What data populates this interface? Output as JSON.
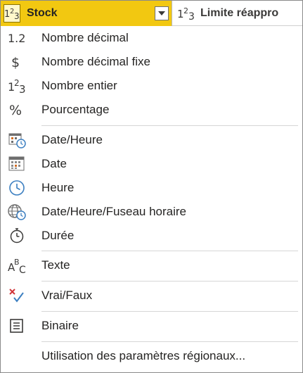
{
  "header": {
    "active_column": {
      "type_icon": "whole-number-icon",
      "name": "Stock",
      "dropdown_icon": "chevron-down-icon"
    },
    "next_column": {
      "type_icon": "whole-number-icon",
      "name": "Limite réappro"
    }
  },
  "menu": {
    "groups": [
      [
        {
          "icon": "decimal-number-icon",
          "label": "Nombre décimal"
        },
        {
          "icon": "currency-icon",
          "label": "Nombre décimal fixe"
        },
        {
          "icon": "whole-number-icon",
          "label": "Nombre entier"
        },
        {
          "icon": "percentage-icon",
          "label": "Pourcentage"
        }
      ],
      [
        {
          "icon": "datetime-icon",
          "label": "Date/Heure"
        },
        {
          "icon": "date-icon",
          "label": "Date"
        },
        {
          "icon": "time-icon",
          "label": "Heure"
        },
        {
          "icon": "datetime-timezone-icon",
          "label": "Date/Heure/Fuseau horaire"
        },
        {
          "icon": "duration-icon",
          "label": "Durée"
        }
      ],
      [
        {
          "icon": "text-icon",
          "label": "Texte"
        }
      ],
      [
        {
          "icon": "true-false-icon",
          "label": "Vrai/Faux"
        }
      ],
      [
        {
          "icon": "binary-icon",
          "label": "Binaire"
        }
      ],
      [
        {
          "icon": "",
          "label": "Utilisation des paramètres régionaux..."
        }
      ]
    ]
  },
  "colors": {
    "header_active_bg": "#f2c811",
    "icon_blue": "#3c7fc1",
    "icon_red": "#d13438",
    "text": "#252423"
  }
}
